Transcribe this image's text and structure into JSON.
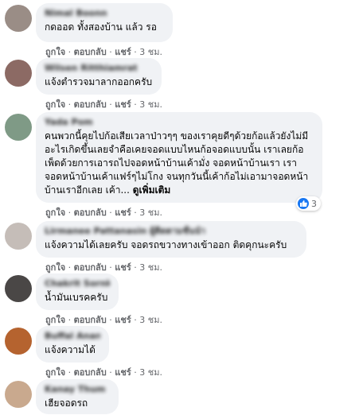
{
  "comments": [
    {
      "author": "Nimal Boonn",
      "text": "กดออด ทั้งสองบ้าน แล้ว รอ",
      "like": "ถูกใจ",
      "reply": "ตอบกลับ",
      "share": "แชร์",
      "time": "3 ชม."
    },
    {
      "author": "Wilsen Ritthiamrat",
      "text": "แจ้งตำรวจมาลากออกครับ",
      "like": "ถูกใจ",
      "reply": "ตอบกลับ",
      "share": "แชร์",
      "time": "3 ชม."
    },
    {
      "author": "Yada Pom",
      "text": "คนพวกนี้คุยไปก้อเสียเวลาป่าวๆๆ ของเราคุยดีๆด้วยก้อแล้วยังไม่มีอะไรเกิดขึ้นเลยจำคือเคยจอดแบบไหนก้อจอดแบบนั้น เราเลยก้อเพ็ดด้วยการเอารถไปจอดหน้าบ้านเค้ามั่ง จอดหน้าบ้านเรา เราจอดหน้าบ้านเค้าแฟร์ๆไม่โกง จนทุกวันนี้เค้าก้อไม่เอามาจอดหน้าบ้านเราอีกเลย เค้า...",
      "see_more": "ดูเพิ่มเติม",
      "like": "ถูกใจ",
      "reply": "ตอบกลับ",
      "share": "แชร์",
      "time": "3 ชม.",
      "reaction_count": "3"
    },
    {
      "author": "Lirmanee Pattanasin ผู้ติดตามชั้นนำ",
      "text": "แจ้งความได้เลยครับ จอดรถขวางทางเข้าออก ติดคุกนะครับ",
      "like": "ถูกใจ",
      "reply": "ตอบกลับ",
      "share": "แชร์",
      "time": "3 ชม."
    },
    {
      "author": "Chakrit Sornkaew",
      "text": "น้ำมันเบรคครับ",
      "like": "ถูกใจ",
      "reply": "ตอบกลับ",
      "share": "แชร์",
      "time": "3 ชม."
    },
    {
      "author": "Buffal Anan",
      "text": "แจ้งความได้",
      "like": "ถูกใจ",
      "reply": "ตอบกลับ",
      "share": "แชร์",
      "time": "3 ชม."
    },
    {
      "author": "Kanay Thum",
      "text": "เฮียจอดรถ"
    }
  ],
  "colors": {
    "like_blue": "#1877f2",
    "bubble_bg": "#f0f2f5",
    "meta_gray": "#65676b"
  },
  "icons": {
    "reaction": "like-icon"
  }
}
